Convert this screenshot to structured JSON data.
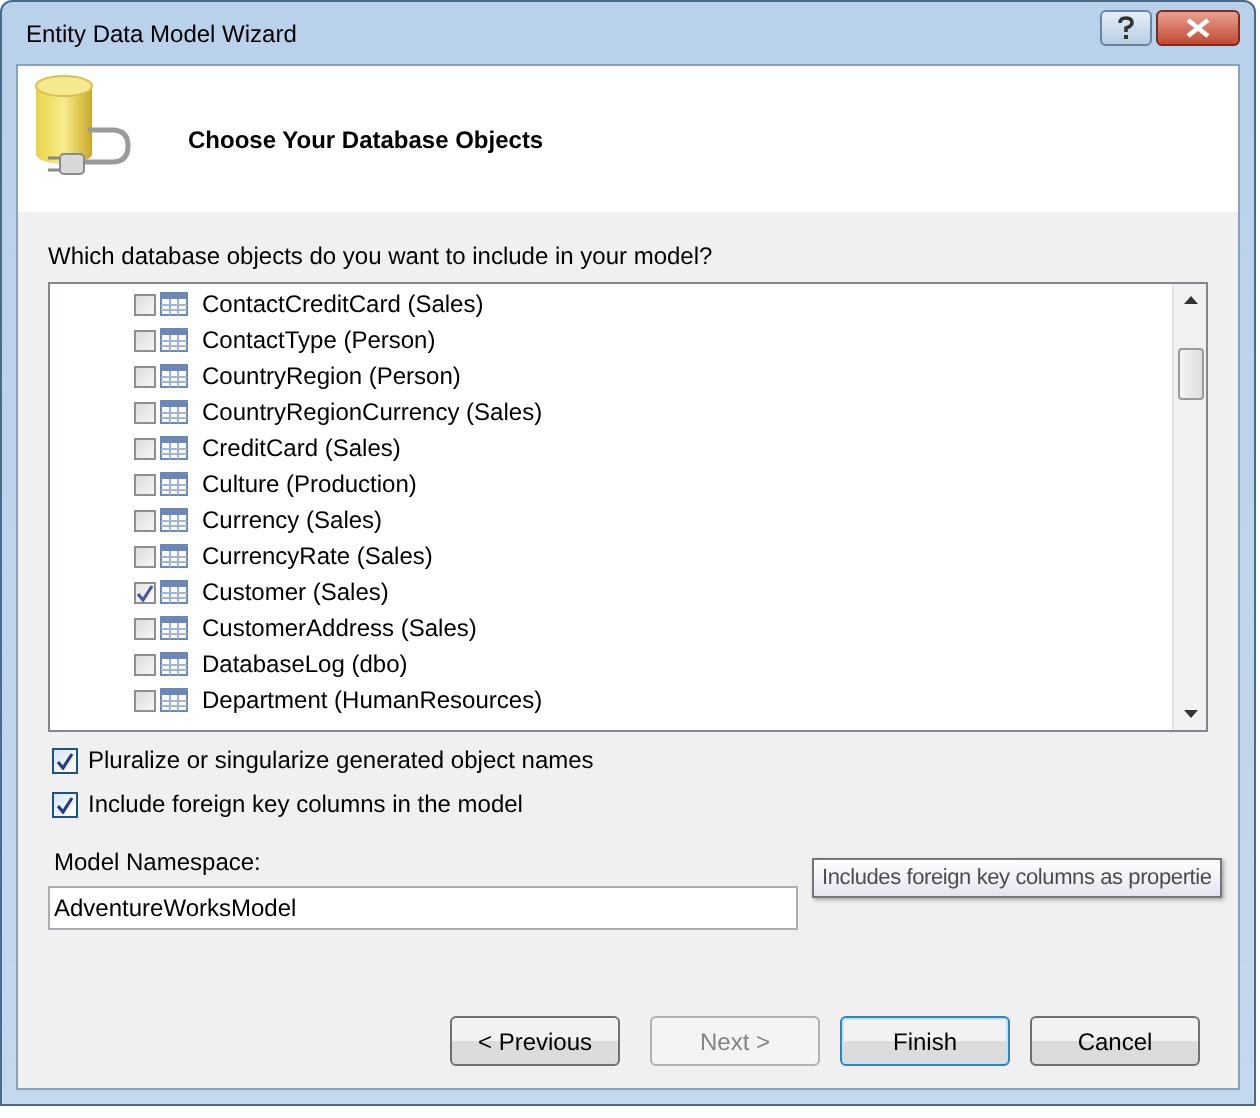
{
  "window": {
    "title": "Entity Data Model Wizard"
  },
  "header": {
    "title": "Choose Your Database Objects"
  },
  "prompt": "Which database objects do you want to include in your model?",
  "objects": [
    {
      "label": "ContactCreditCard (Sales)",
      "checked": false
    },
    {
      "label": "ContactType (Person)",
      "checked": false
    },
    {
      "label": "CountryRegion (Person)",
      "checked": false
    },
    {
      "label": "CountryRegionCurrency (Sales)",
      "checked": false
    },
    {
      "label": "CreditCard (Sales)",
      "checked": false
    },
    {
      "label": "Culture (Production)",
      "checked": false
    },
    {
      "label": "Currency (Sales)",
      "checked": false
    },
    {
      "label": "CurrencyRate (Sales)",
      "checked": false
    },
    {
      "label": "Customer (Sales)",
      "checked": true
    },
    {
      "label": "CustomerAddress (Sales)",
      "checked": false
    },
    {
      "label": "DatabaseLog (dbo)",
      "checked": false
    },
    {
      "label": "Department (HumanResources)",
      "checked": false
    }
  ],
  "options": [
    {
      "label": "Pluralize or singularize generated object names",
      "checked": true
    },
    {
      "label": "Include foreign key columns in the model",
      "checked": true
    }
  ],
  "namespace": {
    "label": "Model Namespace:",
    "value": "AdventureWorksModel"
  },
  "tooltip": "Includes foreign key columns as propertie",
  "buttons": [
    {
      "label": "< Previous",
      "disabled": false,
      "default": false
    },
    {
      "label": "Next >",
      "disabled": true,
      "default": false
    },
    {
      "label": "Finish",
      "disabled": false,
      "default": true
    },
    {
      "label": "Cancel",
      "disabled": false,
      "default": false
    }
  ]
}
